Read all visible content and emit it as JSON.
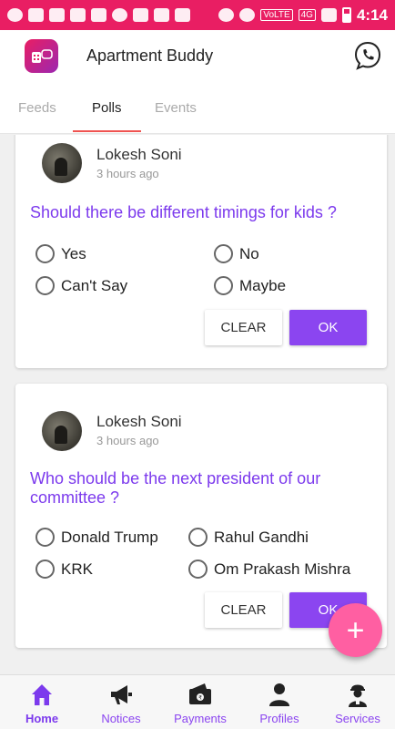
{
  "status_bar": {
    "network": "4G",
    "volte": "VoLTE",
    "time": "4:14"
  },
  "app_bar": {
    "title": "Apartment Buddy"
  },
  "tabs": [
    {
      "label": "Feeds",
      "active": false
    },
    {
      "label": "Polls",
      "active": true
    },
    {
      "label": "Events",
      "active": false
    }
  ],
  "polls": [
    {
      "author": "Lokesh Soni",
      "time": "3 hours ago",
      "question": "Should there be different timings for kids ?",
      "options": [
        "Yes",
        "No",
        "Can't Say",
        "Maybe"
      ],
      "clear_label": "CLEAR",
      "ok_label": "OK"
    },
    {
      "author": "Lokesh Soni",
      "time": "3 hours ago",
      "question": "Who should be the next president of our committee ?",
      "options": [
        "Donald Trump",
        "Rahul Gandhi",
        "KRK",
        "Om Prakash Mishra"
      ],
      "clear_label": "CLEAR",
      "ok_label": "OK"
    }
  ],
  "fab": {
    "symbol": "+"
  },
  "bottom_nav": [
    {
      "label": "Home",
      "icon": "home-icon",
      "active": true
    },
    {
      "label": "Notices",
      "icon": "megaphone-icon",
      "active": false
    },
    {
      "label": "Payments",
      "icon": "wallet-icon",
      "active": false
    },
    {
      "label": "Profiles",
      "icon": "person-icon",
      "active": false
    },
    {
      "label": "Services",
      "icon": "service-person-icon",
      "active": false
    }
  ],
  "colors": {
    "status_bar": "#e91e63",
    "accent": "#8b45f0",
    "question": "#7c3aed",
    "tab_indicator": "#ef5350",
    "fab": "#ff5fa2"
  }
}
